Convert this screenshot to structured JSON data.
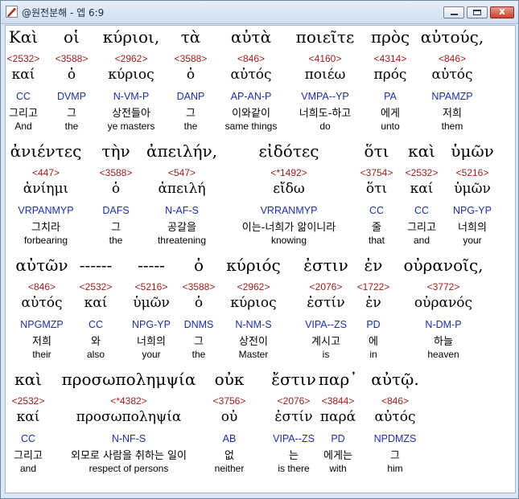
{
  "window": {
    "title": "@원전분해 - 엡 6:9"
  },
  "window_buttons": {
    "close": "x"
  },
  "lines": [
    {
      "words": [
        {
          "greek": "Καὶ",
          "code": "<2532>",
          "lemma": "καί",
          "parse": "CC",
          "korean": "그리고",
          "english": "And"
        },
        {
          "greek": "οἱ",
          "code": "<3588>",
          "lemma": "ὁ",
          "parse": "DVMP",
          "korean": "그",
          "english": "the"
        },
        {
          "greek": "κύριοι,",
          "code": "<2962>",
          "lemma": "κύριος",
          "parse": "N-VM-P",
          "korean": "상전들아",
          "english": "ye masters"
        },
        {
          "greek": "τὰ",
          "code": "<3588>",
          "lemma": "ὁ",
          "parse": "DANP",
          "korean": "그",
          "english": "the"
        },
        {
          "greek": "αὐτὰ",
          "code": "<846>",
          "lemma": "αὐτός",
          "parse": "AP-AN-P",
          "korean": "이와같이",
          "english": "same things"
        },
        {
          "greek": "ποιεῖτε",
          "code": "<4160>",
          "lemma": "ποιέω",
          "parse": "VMPA--YP",
          "korean": "너희도-하고",
          "english": "do"
        },
        {
          "greek": "πρὸς",
          "code": "<4314>",
          "lemma": "πρός",
          "parse": "PA",
          "korean": "에게",
          "english": "unto"
        },
        {
          "greek": "αὐτούς,",
          "code": "<846>",
          "lemma": "αὐτός",
          "parse": "NPAMZP",
          "korean": "저희",
          "english": "them"
        }
      ]
    },
    {
      "words": [
        {
          "greek": "ἀνιέντες",
          "code": "<447>",
          "lemma": "ἀνίημι",
          "parse": "VRPANMYP",
          "korean": "그치라",
          "english": "forbearing"
        },
        {
          "greek": "τὴν",
          "code": "<3588>",
          "lemma": "ὁ",
          "parse": "DAFS",
          "korean": "그",
          "english": "the"
        },
        {
          "greek": "ἀπειλήν,",
          "code": "<547>",
          "lemma": "ἀπειλή",
          "parse": "N-AF-S",
          "korean": "공갈을",
          "english": "threatening"
        },
        {
          "greek": "εἰδότες",
          "code": "<*1492>",
          "lemma": "εἴδω",
          "parse": "VRRANMYP",
          "korean": "이는-너희가 앎이니라",
          "english": "knowing"
        },
        {
          "greek": "ὅτι",
          "code": "<3754>",
          "lemma": "ὅτι",
          "parse": "CC",
          "korean": "줄",
          "english": "that"
        },
        {
          "greek": "καὶ",
          "code": "<2532>",
          "lemma": "καί",
          "parse": "CC",
          "korean": "그리고",
          "english": "and"
        },
        {
          "greek": "ὑμῶν",
          "code": "<5216>",
          "lemma": "ὑμῶν",
          "parse": "NPG-YP",
          "korean": "너희의",
          "english": "your"
        }
      ]
    },
    {
      "words": [
        {
          "greek": "αὐτῶν",
          "code": "<846>",
          "lemma": "αὐτός",
          "parse": "NPGMZP",
          "korean": "저희",
          "english": "their"
        },
        {
          "greek": "------",
          "code": "<2532>",
          "lemma": "καί",
          "parse": "CC",
          "korean": "와",
          "english": "also"
        },
        {
          "greek": "-----",
          "code": "<5216>",
          "lemma": "ὑμῶν",
          "parse": "NPG-YP",
          "korean": "너희의",
          "english": "your"
        },
        {
          "greek": "ὁ",
          "code": "<3588>",
          "lemma": "ὁ",
          "parse": "DNMS",
          "korean": "그",
          "english": "the"
        },
        {
          "greek": "κύριός",
          "code": "<2962>",
          "lemma": "κύριος",
          "parse": "N-NM-S",
          "korean": "상전이",
          "english": "Master"
        },
        {
          "greek": "ἐστιν",
          "code": "<2076>",
          "lemma": "ἐστίν",
          "parse": "VIPA--ZS",
          "korean": "계시고",
          "english": "is"
        },
        {
          "greek": "ἐν",
          "code": "<1722>",
          "lemma": "ἐν",
          "parse": "PD",
          "korean": "에",
          "english": "in"
        },
        {
          "greek": "οὐρανοῖς,",
          "code": "<3772>",
          "lemma": "οὐρανός",
          "parse": "N-DM-P",
          "korean": "하늘",
          "english": "heaven"
        }
      ]
    },
    {
      "words": [
        {
          "greek": "καὶ",
          "code": "<2532>",
          "lemma": "καί",
          "parse": "CC",
          "korean": "그리고",
          "english": "and"
        },
        {
          "greek": "προσωπολημψία",
          "code": "<*4382>",
          "lemma": "προσωποληψία",
          "parse": "N-NF-S",
          "korean": "외모로 사람을 취하는 일이",
          "english": "respect of persons"
        },
        {
          "greek": "οὐκ",
          "code": "<3756>",
          "lemma": "οὐ",
          "parse": "AB",
          "korean": "없",
          "english": "neither"
        },
        {
          "greek": "ἔστιν",
          "code": "<2076>",
          "lemma": "ἐστίν",
          "parse": "VIPA--ZS",
          "korean": "는",
          "english": "is there"
        },
        {
          "greek": "παρ᾽",
          "code": "<3844>",
          "lemma": "παρά",
          "parse": "PD",
          "korean": "에게는",
          "english": "with"
        },
        {
          "greek": "αὐτῷ.",
          "code": "<846>",
          "lemma": "αὐτός",
          "parse": "NPDMZS",
          "korean": "그",
          "english": "him"
        }
      ]
    }
  ],
  "colors": {
    "strong_code": "#9b1a1a",
    "parsing": "#1d2fa8",
    "text": "#000000",
    "background": "#ffffff"
  }
}
